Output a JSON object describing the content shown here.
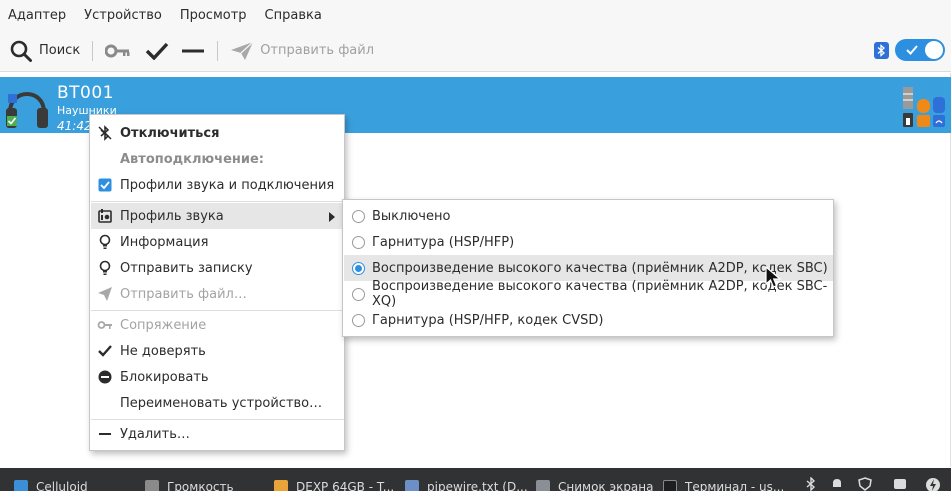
{
  "menubar": {
    "items": [
      "Адаптер",
      "Устройство",
      "Просмотр",
      "Справка"
    ]
  },
  "toolbar": {
    "search_label": "Поиск",
    "send_file_label": "Отправить файл",
    "icons": [
      "search-icon",
      "key-icon",
      "check-icon",
      "minus-icon",
      "paper-plane-icon"
    ],
    "bluetooth_switch_on": true
  },
  "device": {
    "name": "BT001",
    "type": "Наушники",
    "time": "41:42"
  },
  "context_menu": {
    "disconnect": "Отключиться",
    "autoconnect_header": "Автоподключение:",
    "autoconnect_profiles": "Профили звука и подключения",
    "audio_profile": "Профиль звука",
    "info": "Информация",
    "send_note": "Отправить записку",
    "send_file": "Отправить файл…",
    "pairing": "Сопряжение",
    "untrust": "Не доверять",
    "block": "Блокировать",
    "rename": "Переименовать устройство…",
    "remove": "Удалить…"
  },
  "submenu": {
    "items": [
      {
        "label": "Выключено",
        "selected": false
      },
      {
        "label": "Гарнитура (HSP/HFP)",
        "selected": false
      },
      {
        "label": "Воспроизведение высокого качества (приёмник A2DP, кодек SBC)",
        "selected": true
      },
      {
        "label": "Воспроизведение высокого качества (приёмник A2DP, кодек SBC-XQ)",
        "selected": false
      },
      {
        "label": "Гарнитура (HSP/HFP, кодек CVSD)",
        "selected": false
      }
    ]
  },
  "taskbar": {
    "items": [
      "Celluloid",
      "Громкость",
      "DEXP 64GB - T...",
      "pipewire.txt (D...",
      "Снимок экрана",
      "Терминал - us..."
    ]
  },
  "colors": {
    "selection": "#3aa0dd",
    "accent": "#2d8fe0",
    "taskbar": "#303234"
  }
}
